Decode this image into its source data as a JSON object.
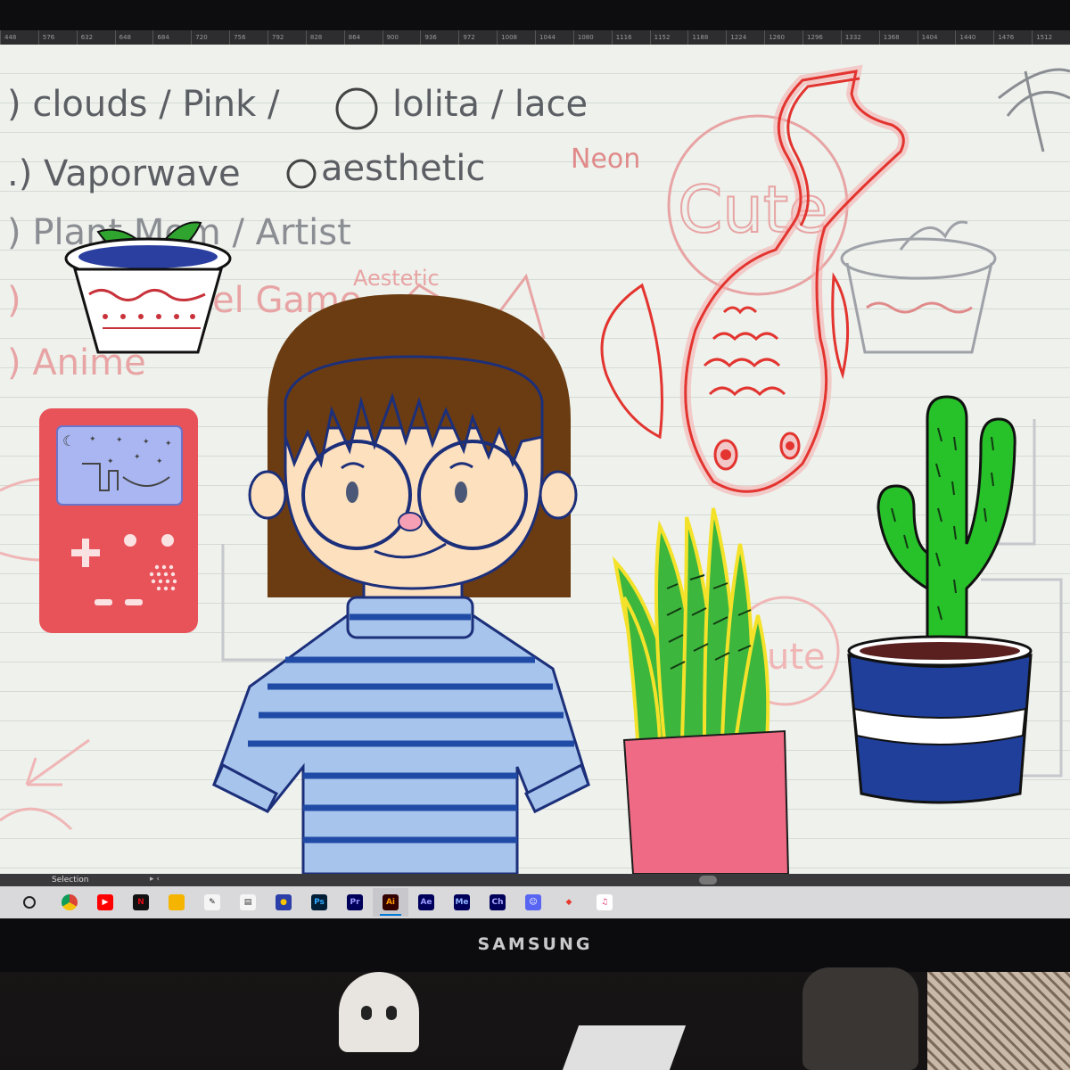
{
  "ruler": {
    "ticks": [
      "448",
      "576",
      "632",
      "648",
      "684",
      "720",
      "756",
      "792",
      "828",
      "864",
      "900",
      "936",
      "972",
      "1008",
      "1044",
      "1080",
      "1116",
      "1152",
      "1188",
      "1224",
      "1260",
      "1296",
      "1332",
      "1368",
      "1404",
      "1440",
      "1476",
      "1512"
    ]
  },
  "notes": {
    "line1": ") clouds / Pink /",
    "line1b": "lolita / lace",
    "line2": ".) Vaporwave",
    "line2b": "aesthetic",
    "line2c": "Neon",
    "line3": ") Plant Mom / Artist",
    "line4": ") ",
    "line4b": "el Game",
    "line4c": "Aestetic",
    "line5": ") Anime"
  },
  "sketch_words": {
    "cute1": "Cute",
    "cute2": "ute"
  },
  "status": {
    "selection": "Selection",
    "nav": "▸ ‹"
  },
  "taskbar": {
    "items": [
      {
        "name": "start-icon",
        "label": "○",
        "color": "#d9d9dc",
        "text": "#222"
      },
      {
        "name": "chrome-icon",
        "label": "",
        "color": "#f4c20d",
        "text": "#fff"
      },
      {
        "name": "youtube-icon",
        "label": "▶",
        "color": "#ff0000",
        "text": "#fff"
      },
      {
        "name": "netflix-icon",
        "label": "N",
        "color": "#111",
        "text": "#e50914"
      },
      {
        "name": "file-explorer-icon",
        "label": "",
        "color": "#f4b400",
        "text": "#fff"
      },
      {
        "name": "clip-studio-icon",
        "label": "✎",
        "color": "#f5f5f5",
        "text": "#222"
      },
      {
        "name": "folder-stack-icon",
        "label": "▤",
        "color": "#f5f5f5",
        "text": "#333"
      },
      {
        "name": "app-icon",
        "label": "●",
        "color": "#2c3ea8",
        "text": "#f7c600"
      },
      {
        "name": "photoshop-icon",
        "label": "Ps",
        "color": "#001e36",
        "text": "#31a8ff"
      },
      {
        "name": "premiere-icon",
        "label": "Pr",
        "color": "#00005b",
        "text": "#9999ff"
      },
      {
        "name": "illustrator-icon",
        "label": "Ai",
        "color": "#330000",
        "text": "#ff9a00"
      },
      {
        "name": "after-effects-icon",
        "label": "Ae",
        "color": "#00005b",
        "text": "#9999ff"
      },
      {
        "name": "media-encoder-icon",
        "label": "Me",
        "color": "#00005b",
        "text": "#8fb4ff"
      },
      {
        "name": "character-animator-icon",
        "label": "Ch",
        "color": "#00005b",
        "text": "#a9a9ff"
      },
      {
        "name": "discord-icon",
        "label": "☺",
        "color": "#5865f2",
        "text": "#fff"
      },
      {
        "name": "diamond-app-icon",
        "label": "◆",
        "color": "#d9d9dc",
        "text": "#e63b2e"
      },
      {
        "name": "itunes-icon",
        "label": "♫",
        "color": "#ffffff",
        "text": "#e0306e"
      }
    ]
  },
  "brand": "SAMSUNG",
  "colors": {
    "neon": "#e3342f",
    "shirt": "#a7c4ec",
    "stripe": "#1f4aa6",
    "hair": "#6b3c12",
    "skin": "#fde0be",
    "game": "#e8535a"
  }
}
